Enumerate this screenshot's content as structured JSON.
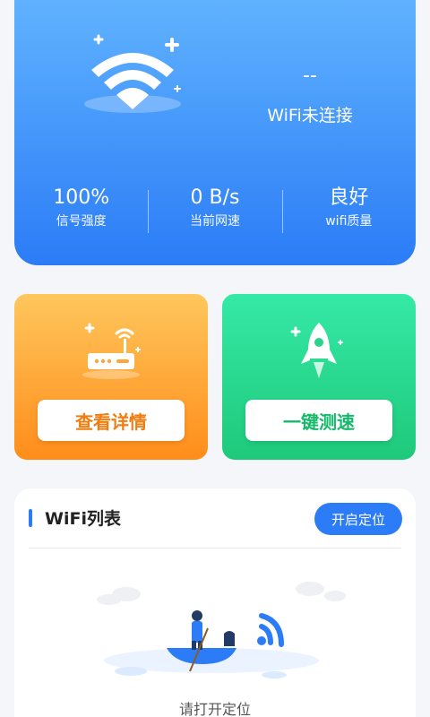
{
  "status_card": {
    "connection_value": "--",
    "connection_status": "WiFi未连接",
    "metrics": [
      {
        "value": "100%",
        "label": "信号强度"
      },
      {
        "value": "0 B/s",
        "label": "当前网速"
      },
      {
        "value": "良好",
        "label": "wifi质量"
      }
    ]
  },
  "actions": {
    "detail_label": "查看详情",
    "speed_label": "一键测速"
  },
  "wifi_list": {
    "title": "WiFi列表",
    "locate_button": "开启定位",
    "empty_message": "请打开定位"
  },
  "icons": {
    "wifi": "wifi-icon",
    "router": "router-icon",
    "rocket": "rocket-icon"
  },
  "colors": {
    "primary": "#2b7cf6",
    "orange": "#ff8d1a",
    "green": "#1ec97a"
  }
}
